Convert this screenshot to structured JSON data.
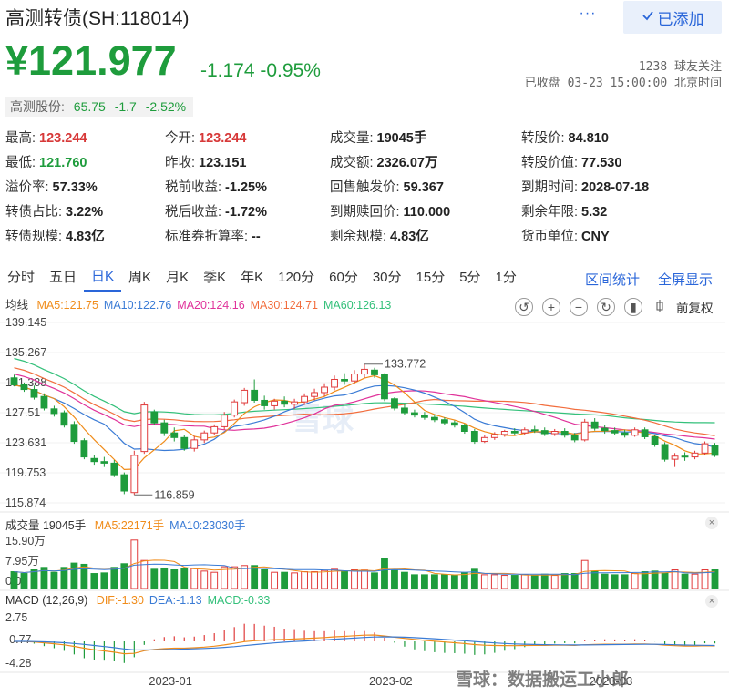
{
  "header": {
    "title": "高测转债(SH:118014)",
    "more_icon": "···",
    "added_label": "已添加",
    "price": "¥121.977",
    "change": "-1.174 -0.95%",
    "followers": "1238 球友关注",
    "market_status": "已收盘 03-23 15:00:00 北京时间"
  },
  "stock_tag": {
    "label": "高测股份:",
    "price": "65.75",
    "change": "-1.7",
    "pct": "-2.52%"
  },
  "quote": [
    [
      {
        "label": "最高:",
        "value": "123.244",
        "color": "red"
      },
      {
        "label": "今开:",
        "value": "123.244",
        "color": "red"
      },
      {
        "label": "成交量:",
        "value": "19045手"
      },
      {
        "label": "转股价:",
        "value": "84.810"
      }
    ],
    [
      {
        "label": "最低:",
        "value": "121.760",
        "color": "green"
      },
      {
        "label": "昨收:",
        "value": "123.151"
      },
      {
        "label": "成交额:",
        "value": "2326.07万"
      },
      {
        "label": "转股价值:",
        "value": "77.530"
      }
    ],
    [
      {
        "label": "溢价率:",
        "value": "57.33%"
      },
      {
        "label": "税前收益:",
        "value": "-1.25%"
      },
      {
        "label": "回售触发价:",
        "value": "59.367"
      },
      {
        "label": "到期时间:",
        "value": "2028-07-18"
      }
    ],
    [
      {
        "label": "转债占比:",
        "value": "3.22%"
      },
      {
        "label": "税后收益:",
        "value": "-1.72%"
      },
      {
        "label": "到期赎回价:",
        "value": "110.000"
      },
      {
        "label": "剩余年限:",
        "value": "5.32"
      }
    ],
    [
      {
        "label": "转债规模:",
        "value": "4.83亿"
      },
      {
        "label": "标准券折算率:",
        "value": "--"
      },
      {
        "label": "剩余规模:",
        "value": "4.83亿"
      },
      {
        "label": "货币单位:",
        "value": "CNY"
      }
    ]
  ],
  "tabs": [
    "分时",
    "五日",
    "日K",
    "周K",
    "月K",
    "季K",
    "年K",
    "120分",
    "60分",
    "30分",
    "15分",
    "5分",
    "1分"
  ],
  "active_tab": "日K",
  "range_stat": "区间统计",
  "fullscreen": "全屏显示",
  "kline_legend": {
    "title": "均线",
    "items": [
      {
        "text": "MA5:121.75",
        "color": "#f08c1a"
      },
      {
        "text": "MA10:122.76",
        "color": "#3a7bd5"
      },
      {
        "text": "MA20:124.16",
        "color": "#e0329a"
      },
      {
        "text": "MA30:124.71",
        "color": "#f26d3d"
      },
      {
        "text": "MA60:126.13",
        "color": "#33c07a"
      }
    ]
  },
  "toolbar": {
    "undo_icon": "↺",
    "zoom_in_icon": "+",
    "zoom_out_icon": "−",
    "next_icon": "↻",
    "candle_icon": "▮",
    "adjust_label": "前复权"
  },
  "vol_legend": {
    "title": "成交量 19045手",
    "items": [
      {
        "text": "MA5:22171手",
        "color": "#f08c1a"
      },
      {
        "text": "MA10:23030手",
        "color": "#3a7bd5"
      }
    ]
  },
  "macd_legend": {
    "title": "MACD (12,26,9)",
    "items": [
      {
        "text": "DIF:-1.30",
        "color": "#f08c1a"
      },
      {
        "text": "DEA:-1.13",
        "color": "#3a7bd5"
      },
      {
        "text": "MACD:-0.33",
        "color": "#33c07a"
      }
    ]
  },
  "close_icon": "×",
  "watermark": "雪球",
  "footer_watermark": "雪球：数据搬运工小郎",
  "chart_data": {
    "type": "candlestick",
    "y_ticks": [
      "139.145",
      "135.267",
      "131.388",
      "127.51",
      "123.631",
      "119.753",
      "115.874"
    ],
    "ylim": [
      115.874,
      139.145
    ],
    "annotations": [
      {
        "text": "133.772",
        "kind": "high"
      },
      {
        "text": "116.859",
        "kind": "low"
      }
    ],
    "x_ticks": [
      "2023-01",
      "2023-02",
      "2023-03"
    ],
    "ohlc": [
      [
        132.0,
        132.4,
        130.9,
        131.1
      ],
      [
        131.2,
        131.4,
        130.2,
        130.5
      ],
      [
        130.5,
        131.0,
        129.2,
        129.5
      ],
      [
        129.6,
        130.0,
        127.8,
        128.1
      ],
      [
        128.0,
        128.4,
        127.0,
        127.4
      ],
      [
        127.5,
        127.8,
        125.6,
        125.9
      ],
      [
        126.0,
        126.4,
        123.5,
        123.8
      ],
      [
        123.9,
        124.2,
        121.5,
        121.8
      ],
      [
        121.6,
        122.0,
        120.8,
        121.2
      ],
      [
        121.2,
        121.8,
        120.5,
        121.0
      ],
      [
        121.0,
        121.4,
        119.2,
        119.5
      ],
      [
        119.5,
        119.8,
        117.0,
        117.4
      ],
      [
        117.2,
        122.6,
        116.9,
        122.0
      ],
      [
        122.5,
        128.9,
        122.2,
        128.5
      ],
      [
        127.6,
        127.9,
        126.0,
        126.2
      ],
      [
        126.2,
        126.6,
        124.5,
        124.9
      ],
      [
        124.9,
        125.6,
        123.8,
        124.3
      ],
      [
        124.3,
        124.6,
        122.6,
        122.9
      ],
      [
        122.9,
        124.5,
        122.5,
        124.0
      ],
      [
        124.0,
        125.2,
        123.6,
        124.9
      ],
      [
        124.9,
        126.0,
        124.6,
        125.7
      ],
      [
        125.7,
        127.6,
        125.3,
        127.2
      ],
      [
        127.2,
        129.2,
        126.9,
        128.9
      ],
      [
        128.8,
        130.7,
        128.4,
        130.4
      ],
      [
        130.4,
        131.8,
        128.8,
        129.1
      ],
      [
        129.1,
        129.7,
        127.9,
        128.4
      ],
      [
        128.4,
        129.3,
        127.9,
        129.0
      ],
      [
        129.0,
        129.6,
        128.2,
        128.6
      ],
      [
        128.6,
        129.3,
        128.0,
        128.9
      ],
      [
        128.9,
        130.0,
        128.5,
        129.6
      ],
      [
        129.6,
        130.6,
        129.1,
        130.1
      ],
      [
        130.1,
        131.3,
        129.6,
        130.8
      ],
      [
        130.8,
        132.3,
        130.4,
        131.8
      ],
      [
        131.8,
        132.6,
        131.1,
        131.6
      ],
      [
        131.6,
        133.0,
        131.2,
        132.5
      ],
      [
        132.5,
        133.772,
        132.0,
        133.1
      ],
      [
        133.0,
        133.3,
        132.0,
        132.4
      ],
      [
        132.4,
        132.6,
        129.0,
        129.3
      ],
      [
        129.3,
        129.5,
        127.8,
        128.1
      ],
      [
        128.1,
        128.6,
        127.2,
        127.5
      ],
      [
        127.5,
        127.9,
        126.9,
        127.2
      ],
      [
        127.2,
        127.6,
        126.6,
        126.9
      ],
      [
        126.9,
        127.3,
        126.3,
        126.6
      ],
      [
        126.6,
        126.9,
        125.9,
        126.2
      ],
      [
        126.2,
        126.5,
        125.6,
        125.9
      ],
      [
        125.9,
        126.1,
        124.8,
        125.1
      ],
      [
        125.1,
        125.4,
        123.5,
        123.8
      ],
      [
        123.8,
        124.6,
        123.6,
        124.3
      ],
      [
        124.3,
        125.0,
        124.0,
        124.7
      ],
      [
        124.7,
        125.3,
        124.4,
        125.1
      ],
      [
        125.1,
        125.5,
        124.6,
        124.9
      ],
      [
        124.9,
        125.6,
        124.6,
        125.3
      ],
      [
        125.3,
        125.8,
        124.9,
        125.2
      ],
      [
        125.2,
        125.6,
        124.5,
        124.8
      ],
      [
        124.8,
        125.4,
        124.5,
        125.1
      ],
      [
        125.1,
        125.5,
        124.3,
        124.6
      ],
      [
        124.6,
        124.9,
        123.7,
        124.0
      ],
      [
        124.0,
        126.7,
        123.8,
        126.3
      ],
      [
        126.3,
        126.8,
        125.2,
        125.5
      ],
      [
        125.5,
        125.9,
        124.8,
        125.2
      ],
      [
        125.2,
        125.6,
        124.6,
        124.9
      ],
      [
        124.9,
        125.3,
        124.3,
        124.6
      ],
      [
        124.6,
        125.6,
        124.4,
        125.3
      ],
      [
        125.3,
        125.6,
        124.1,
        124.4
      ],
      [
        124.4,
        124.7,
        123.1,
        123.4
      ],
      [
        123.4,
        123.7,
        121.2,
        121.5
      ],
      [
        121.5,
        122.3,
        120.5,
        121.9
      ],
      [
        121.9,
        122.4,
        121.3,
        121.8
      ],
      [
        121.8,
        122.6,
        121.5,
        122.3
      ],
      [
        122.3,
        123.8,
        122.0,
        123.5
      ],
      [
        123.3,
        123.6,
        121.8,
        122.0
      ]
    ]
  }
}
